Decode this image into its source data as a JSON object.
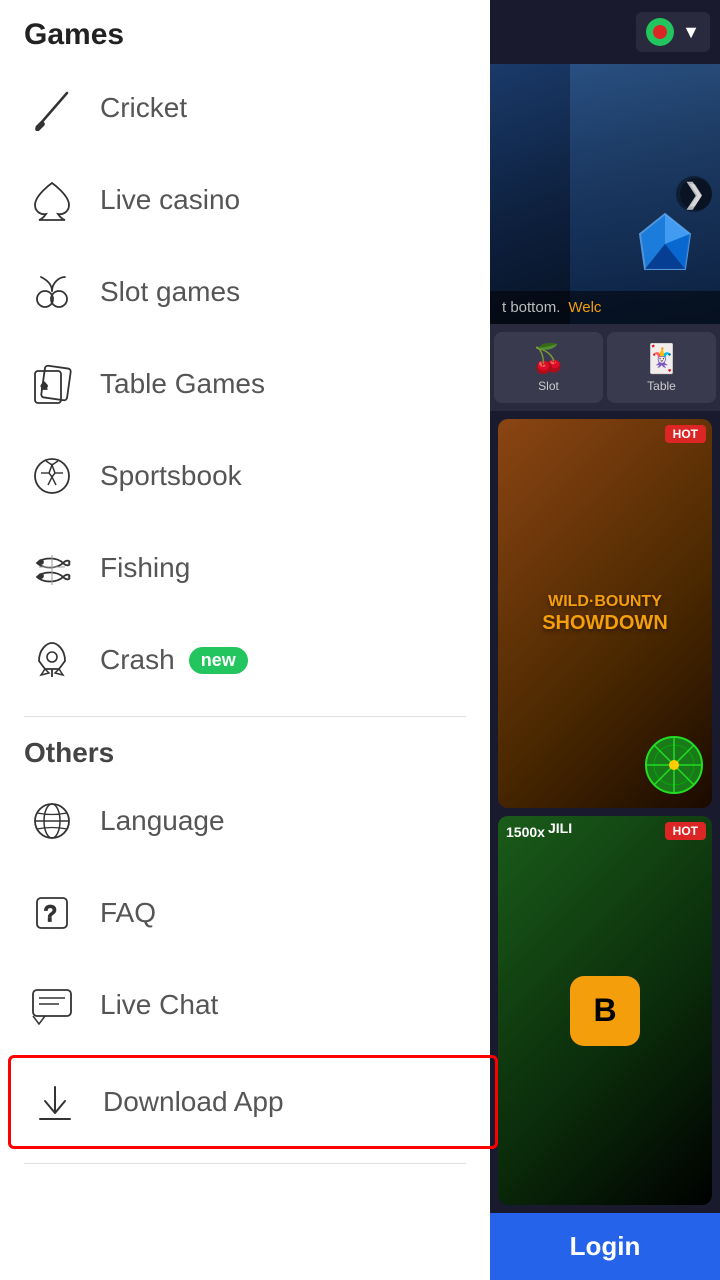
{
  "sidebar": {
    "games_section_title": "Games",
    "others_section_title": "Others",
    "games_items": [
      {
        "id": "cricket",
        "label": "Cricket",
        "icon": "cricket"
      },
      {
        "id": "live-casino",
        "label": "Live casino",
        "icon": "spade"
      },
      {
        "id": "slot-games",
        "label": "Slot games",
        "icon": "cherry"
      },
      {
        "id": "table-games",
        "label": "Table Games",
        "icon": "cards"
      },
      {
        "id": "sportsbook",
        "label": "Sportsbook",
        "icon": "soccer"
      },
      {
        "id": "fishing",
        "label": "Fishing",
        "icon": "fish"
      },
      {
        "id": "crash",
        "label": "Crash",
        "icon": "rocket",
        "badge": "new"
      }
    ],
    "others_items": [
      {
        "id": "language",
        "label": "Language",
        "icon": "globe"
      },
      {
        "id": "faq",
        "label": "FAQ",
        "icon": "question"
      },
      {
        "id": "live-chat",
        "label": "Live Chat",
        "icon": "chat"
      },
      {
        "id": "download-app",
        "label": "Download App",
        "icon": "download",
        "highlighted": true
      }
    ]
  },
  "header": {
    "flag_alt": "Bangladesh flag"
  },
  "banner": {
    "text_dark": "t bottom.",
    "text_yellow": "Welc"
  },
  "categories": [
    {
      "id": "slot",
      "label": "Slot",
      "icon": "🍒"
    },
    {
      "id": "table",
      "label": "Table",
      "icon": "🃏"
    }
  ],
  "games": [
    {
      "id": "wild-bounty",
      "title": "Wild Bounty Showdown",
      "badge": "HOT",
      "type": "wild"
    },
    {
      "id": "jili",
      "title": "Jili",
      "badge": "HOT",
      "type": "jili",
      "multiplier": "1500x"
    }
  ],
  "login_label": "Login"
}
